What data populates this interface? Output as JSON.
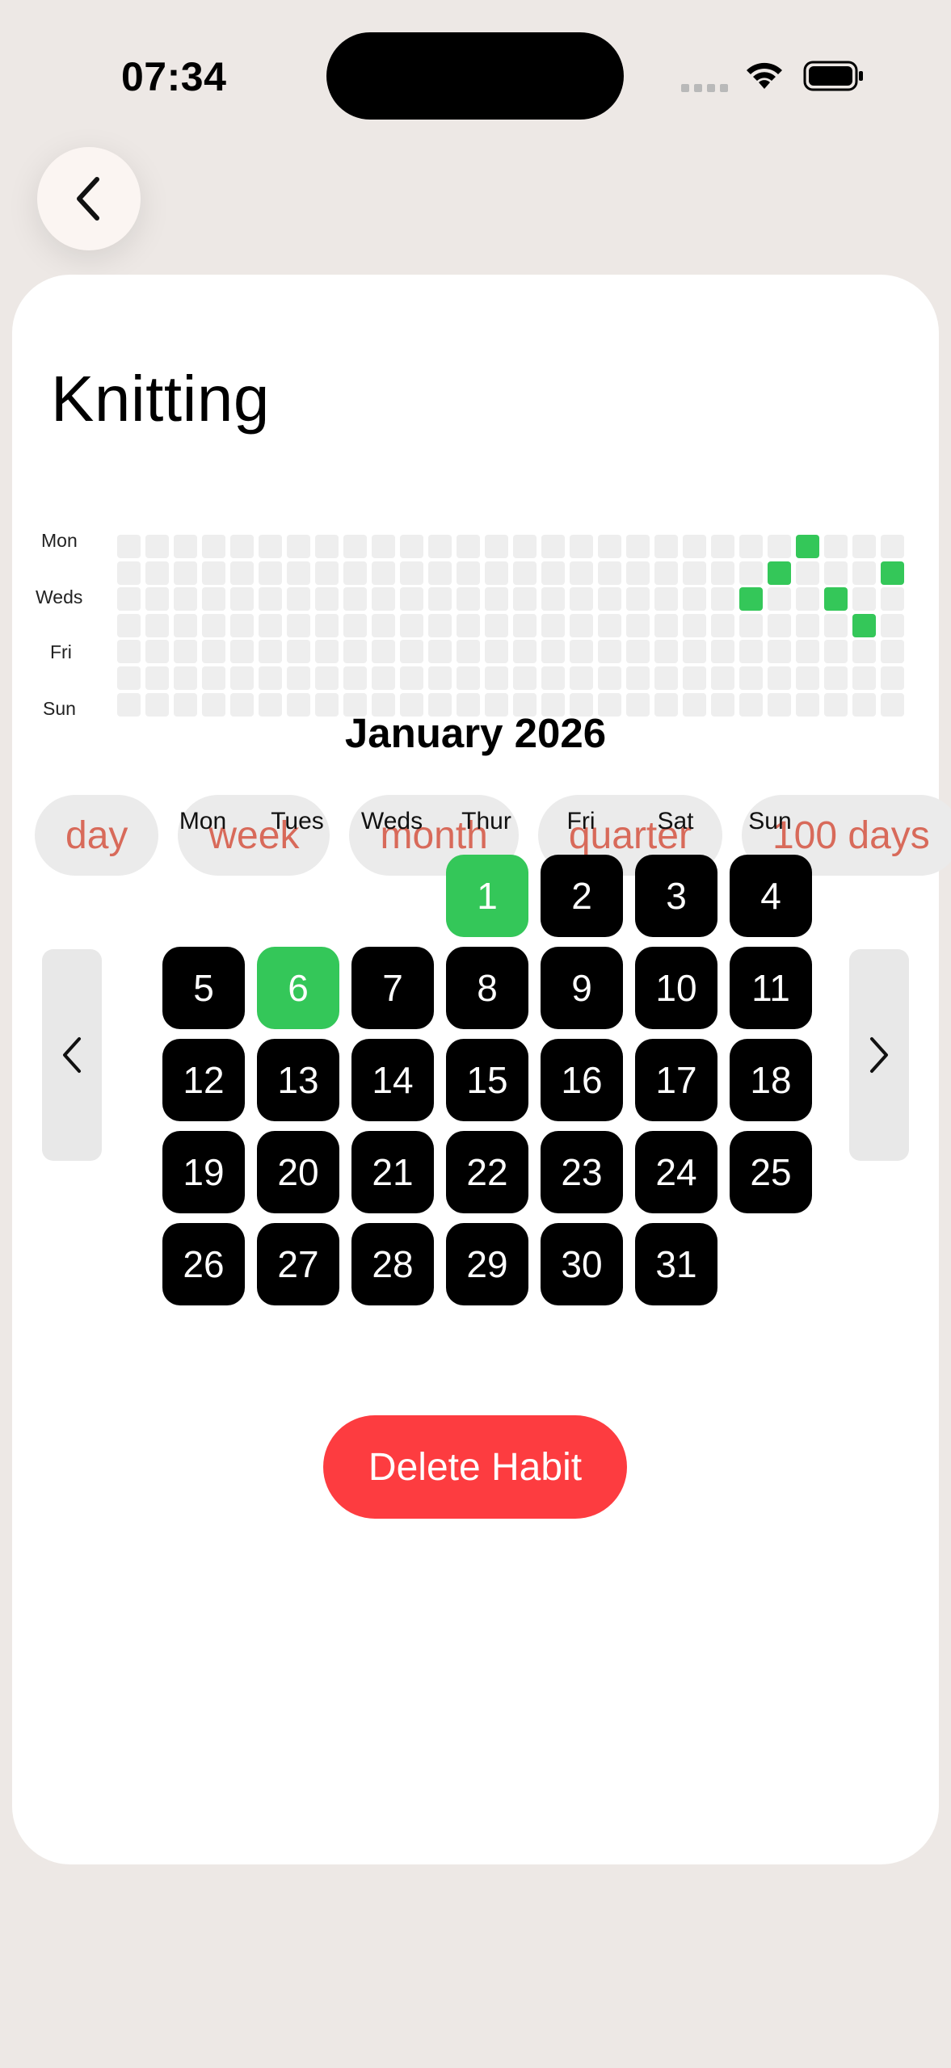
{
  "status_bar": {
    "time": "07:34"
  },
  "habit": {
    "title": "Knitting"
  },
  "heatmap": {
    "row_labels": [
      "Mon",
      "Weds",
      "Fri",
      "Sun"
    ],
    "weeks": 28,
    "days_per_week": 7,
    "filled": [
      [
        22,
        2
      ],
      [
        23,
        1
      ],
      [
        24,
        0
      ],
      [
        25,
        2
      ],
      [
        26,
        3
      ],
      [
        27,
        1
      ]
    ]
  },
  "periods": [
    "day",
    "week",
    "month",
    "quarter",
    "100 days"
  ],
  "calendar": {
    "month_title": "January 2026",
    "weekdays": [
      "Mon",
      "Tues",
      "Weds",
      "Thur",
      "Fri",
      "Sat",
      "Sun"
    ],
    "first_weekday_index": 3,
    "days_in_month": 31,
    "completed_days": [
      1,
      6
    ]
  },
  "actions": {
    "delete_label": "Delete Habit"
  },
  "colors": {
    "background": "#ede8e5",
    "accent_green": "#34c759",
    "delete_red": "#fd3c40",
    "pill_text": "#d86a5a"
  }
}
